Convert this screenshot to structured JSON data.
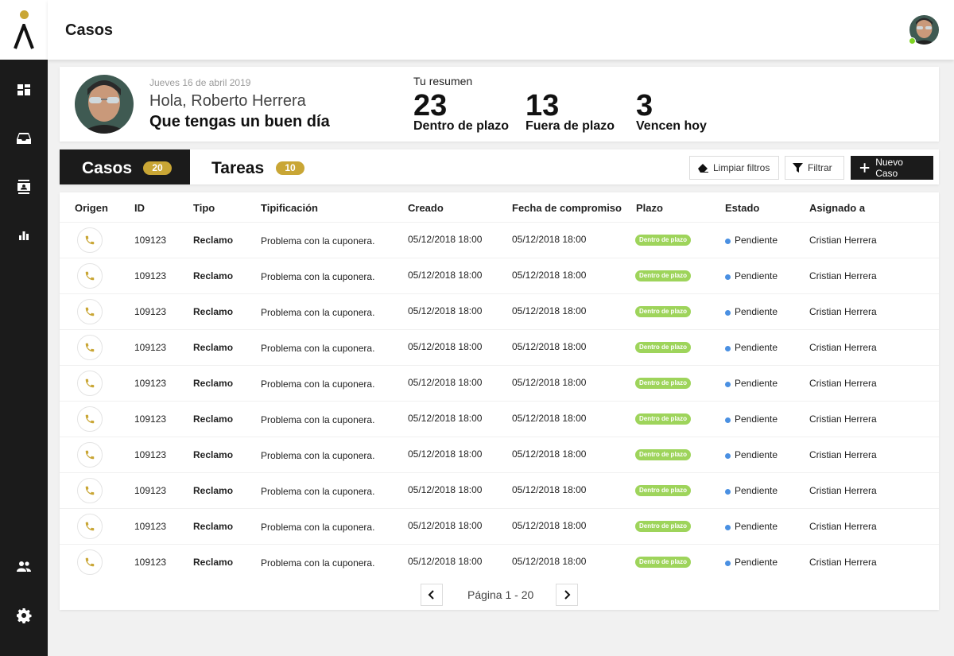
{
  "header": {
    "title": "Casos"
  },
  "welcome": {
    "date": "Jueves 16 de abril 2019",
    "greeting": "Hola, Roberto Herrera",
    "subtitle": "Que tengas un buen día",
    "summary_label": "Tu resumen",
    "stats": [
      {
        "value": "23",
        "label": "Dentro de plazo"
      },
      {
        "value": "13",
        "label": "Fuera de plazo"
      },
      {
        "value": "3",
        "label": "Vencen hoy"
      }
    ]
  },
  "tabs": [
    {
      "label": "Casos",
      "count": "20",
      "active": true
    },
    {
      "label": "Tareas",
      "count": "10",
      "active": false
    }
  ],
  "actions": {
    "clear": "Limpiar filtros",
    "filter": "Filtrar",
    "new": "Nuevo Caso"
  },
  "table": {
    "columns": [
      "Origen",
      "ID",
      "Tipo",
      "Tipificación",
      "Creado",
      "Fecha de compromiso",
      "Plazo",
      "Estado",
      "Asignado a"
    ],
    "rows": [
      {
        "origin_icon": "phone-icon",
        "id": "109123",
        "tipo": "Reclamo",
        "tipificacion": "Problema con la cuponera.",
        "creado": "05/12/2018 18:00",
        "compromiso": "05/12/2018 18:00",
        "plazo": "Dentro de plazo",
        "estado": "Pendiente",
        "asignado": "Cristian Herrera"
      },
      {
        "origin_icon": "phone-icon",
        "id": "109123",
        "tipo": "Reclamo",
        "tipificacion": "Problema con la cuponera.",
        "creado": "05/12/2018 18:00",
        "compromiso": "05/12/2018 18:00",
        "plazo": "Dentro de plazo",
        "estado": "Pendiente",
        "asignado": "Cristian Herrera"
      },
      {
        "origin_icon": "phone-icon",
        "id": "109123",
        "tipo": "Reclamo",
        "tipificacion": "Problema con la cuponera.",
        "creado": "05/12/2018 18:00",
        "compromiso": "05/12/2018 18:00",
        "plazo": "Dentro de plazo",
        "estado": "Pendiente",
        "asignado": "Cristian Herrera"
      },
      {
        "origin_icon": "phone-icon",
        "id": "109123",
        "tipo": "Reclamo",
        "tipificacion": "Problema con la cuponera.",
        "creado": "05/12/2018 18:00",
        "compromiso": "05/12/2018 18:00",
        "plazo": "Dentro de plazo",
        "estado": "Pendiente",
        "asignado": "Cristian Herrera"
      },
      {
        "origin_icon": "phone-icon",
        "id": "109123",
        "tipo": "Reclamo",
        "tipificacion": "Problema con la cuponera.",
        "creado": "05/12/2018 18:00",
        "compromiso": "05/12/2018 18:00",
        "plazo": "Dentro de plazo",
        "estado": "Pendiente",
        "asignado": "Cristian Herrera"
      },
      {
        "origin_icon": "phone-icon",
        "id": "109123",
        "tipo": "Reclamo",
        "tipificacion": "Problema con la cuponera.",
        "creado": "05/12/2018 18:00",
        "compromiso": "05/12/2018 18:00",
        "plazo": "Dentro de plazo",
        "estado": "Pendiente",
        "asignado": "Cristian Herrera"
      },
      {
        "origin_icon": "phone-icon",
        "id": "109123",
        "tipo": "Reclamo",
        "tipificacion": "Problema con la cuponera.",
        "creado": "05/12/2018 18:00",
        "compromiso": "05/12/2018 18:00",
        "plazo": "Dentro de plazo",
        "estado": "Pendiente",
        "asignado": "Cristian Herrera"
      },
      {
        "origin_icon": "phone-icon",
        "id": "109123",
        "tipo": "Reclamo",
        "tipificacion": "Problema con la cuponera.",
        "creado": "05/12/2018 18:00",
        "compromiso": "05/12/2018 18:00",
        "plazo": "Dentro de plazo",
        "estado": "Pendiente",
        "asignado": "Cristian Herrera"
      },
      {
        "origin_icon": "phone-icon",
        "id": "109123",
        "tipo": "Reclamo",
        "tipificacion": "Problema con la cuponera.",
        "creado": "05/12/2018 18:00",
        "compromiso": "05/12/2018 18:00",
        "plazo": "Dentro de plazo",
        "estado": "Pendiente",
        "asignado": "Cristian Herrera"
      },
      {
        "origin_icon": "phone-icon",
        "id": "109123",
        "tipo": "Reclamo",
        "tipificacion": "Problema con la cuponera.",
        "creado": "05/12/2018 18:00",
        "compromiso": "05/12/2018 18:00",
        "plazo": "Dentro de plazo",
        "estado": "Pendiente",
        "asignado": "Cristian Herrera"
      }
    ]
  },
  "pagination": {
    "label": "Página 1 - 20"
  },
  "sidebar": {
    "icons": [
      "dashboard-icon",
      "inbox-icon",
      "contacts-icon",
      "reports-icon",
      "team-icon",
      "settings-icon"
    ]
  },
  "colors": {
    "accent": "#c9a635",
    "sidebar": "#1b1b1b",
    "plazo_ok": "#9ed45b",
    "estado_pendiente": "#4a90e2",
    "online": "#7ed321"
  }
}
